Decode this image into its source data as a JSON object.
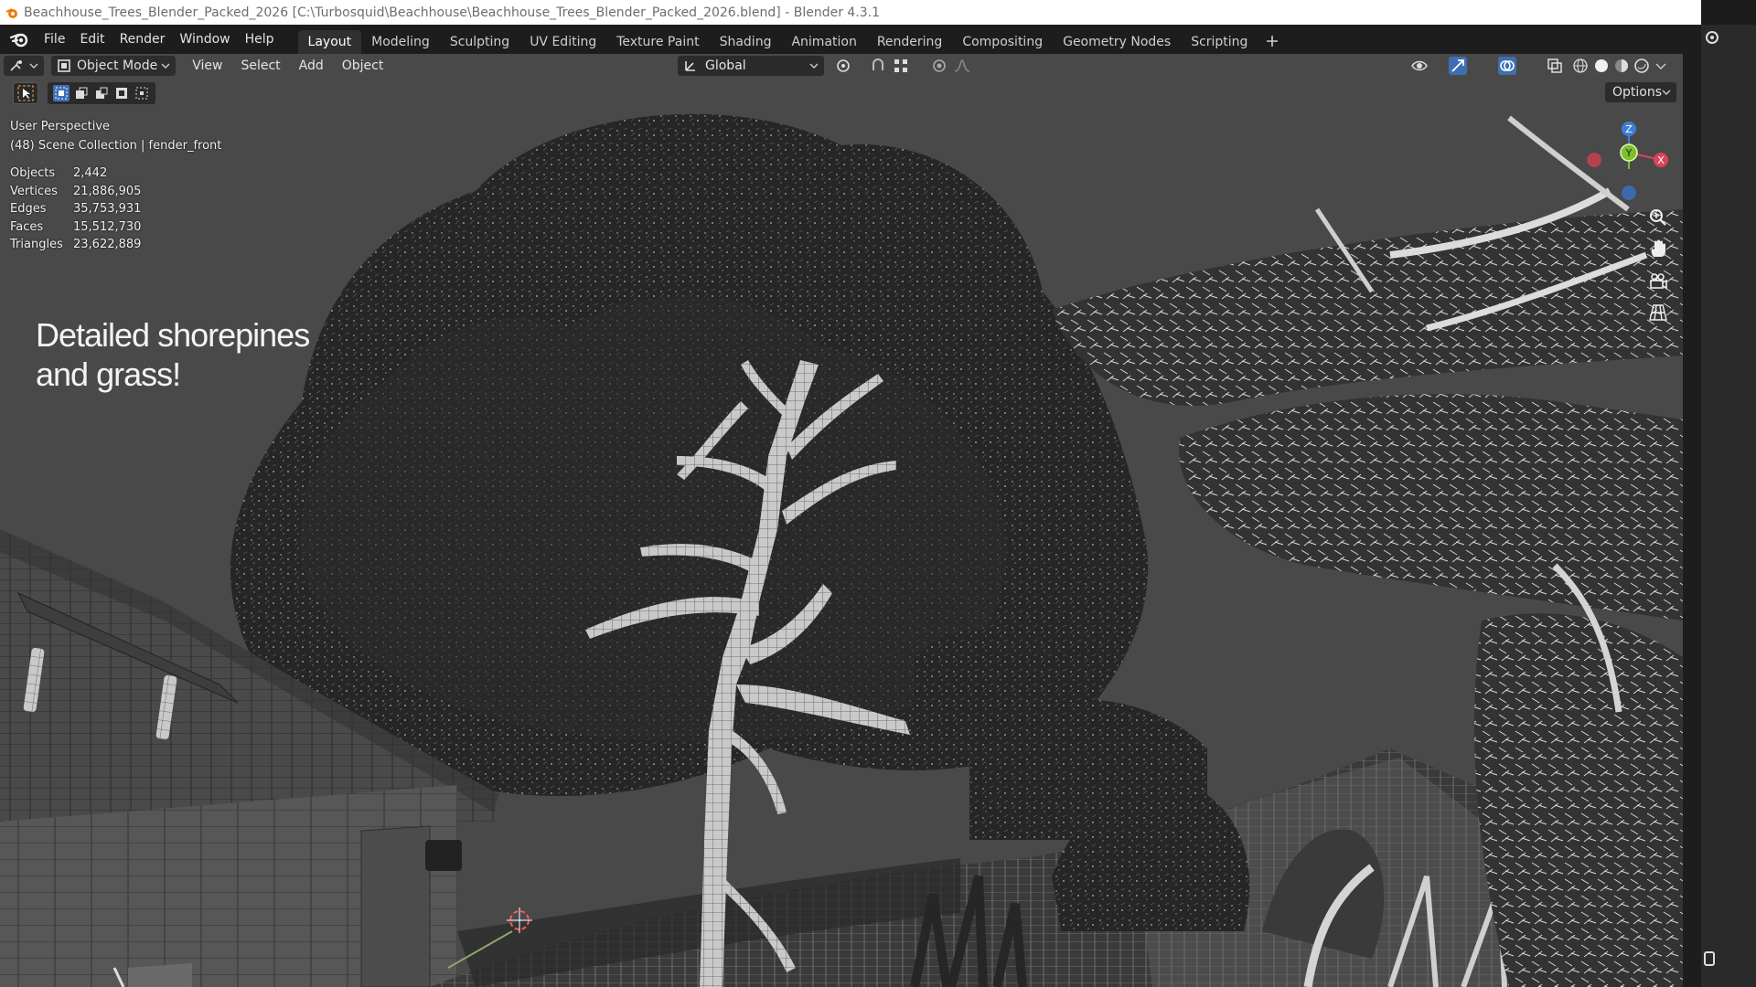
{
  "window": {
    "title": "Beachhouse_Trees_Blender_Packed_2026 [C:\\Turbosquid\\Beachhouse\\Beachhouse_Trees_Blender_Packed_2026.blend] - Blender 4.3.1"
  },
  "menu": [
    "File",
    "Edit",
    "Render",
    "Window",
    "Help"
  ],
  "workspace_tabs": [
    {
      "label": "Layout",
      "active": true
    },
    {
      "label": "Modeling",
      "active": false
    },
    {
      "label": "Sculpting",
      "active": false
    },
    {
      "label": "UV Editing",
      "active": false
    },
    {
      "label": "Texture Paint",
      "active": false
    },
    {
      "label": "Shading",
      "active": false
    },
    {
      "label": "Animation",
      "active": false
    },
    {
      "label": "Rendering",
      "active": false
    },
    {
      "label": "Compositing",
      "active": false
    },
    {
      "label": "Geometry Nodes",
      "active": false
    },
    {
      "label": "Scripting",
      "active": false
    }
  ],
  "viewport_header": {
    "mode": "Object Mode",
    "menus": [
      "View",
      "Select",
      "Add",
      "Object"
    ],
    "transform_orientation": "Global",
    "options_label": "Options"
  },
  "overlay": {
    "view_name": "User Perspective",
    "collection": "(48) Scene Collection | fender_front",
    "stats": [
      {
        "label": "Objects",
        "value": "2,442"
      },
      {
        "label": "Vertices",
        "value": "21,886,905"
      },
      {
        "label": "Edges",
        "value": "35,753,931"
      },
      {
        "label": "Faces",
        "value": "15,512,730"
      },
      {
        "label": "Triangles",
        "value": "23,622,889"
      }
    ]
  },
  "promo_text": [
    "Detailed shorepines",
    "and grass!"
  ],
  "gizmo_axes": {
    "x": "X",
    "y": "Y",
    "z": "Z"
  },
  "colors": {
    "x_axis": "#d9445a",
    "y_axis": "#7fbf2e",
    "z_axis": "#3d7fd6",
    "viewport_bg": "#494949",
    "ui_dark": "#1d1d1d",
    "active_tab": "#303030"
  }
}
